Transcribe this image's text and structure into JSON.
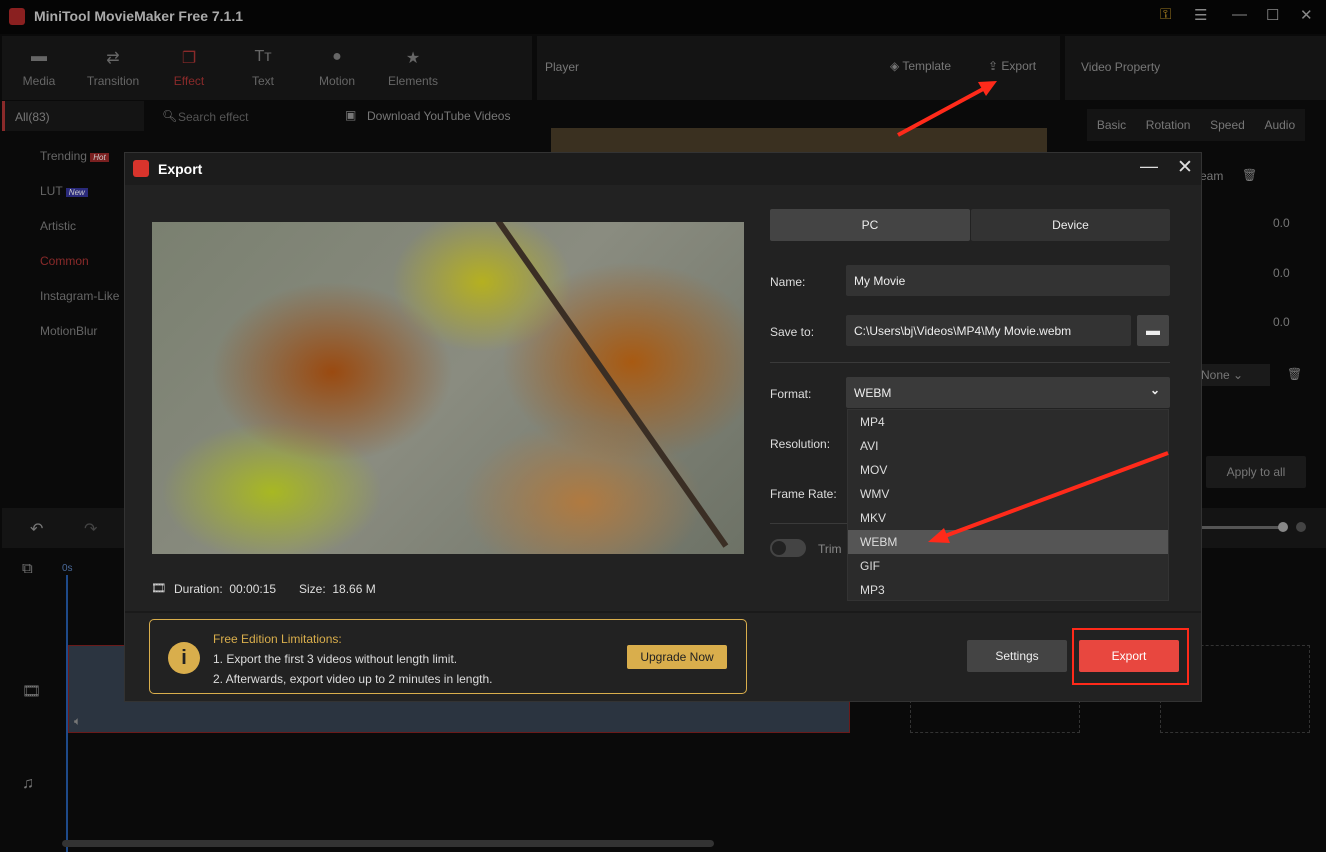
{
  "app": {
    "title": "MiniTool MovieMaker Free 7.1.1"
  },
  "toolbar": [
    {
      "label": "Media",
      "icon": "folder-icon"
    },
    {
      "label": "Transition",
      "icon": "transition-icon"
    },
    {
      "label": "Effect",
      "icon": "effect-icon"
    },
    {
      "label": "Text",
      "icon": "text-icon"
    },
    {
      "label": "Motion",
      "icon": "motion-icon"
    },
    {
      "label": "Elements",
      "icon": "elements-icon"
    }
  ],
  "effects": {
    "all": "All(83)",
    "search_placeholder": "Search effect",
    "download": "Download YouTube Videos",
    "categories": [
      {
        "label": "Trending",
        "badge": "Hot"
      },
      {
        "label": "LUT",
        "badge": "New"
      },
      {
        "label": "Artistic"
      },
      {
        "label": "Common"
      },
      {
        "label": "Instagram-Like"
      },
      {
        "label": "MotionBlur"
      }
    ]
  },
  "player": {
    "title": "Player",
    "template": "Template",
    "export": "Export"
  },
  "property": {
    "title": "Video Property",
    "tabs": [
      "Basic",
      "Rotation",
      "Speed",
      "Audio"
    ],
    "partial": "eam",
    "values": [
      "0.0",
      "0.0",
      "0.0"
    ],
    "none": "None",
    "apply_all": "Apply to all"
  },
  "timeline": {
    "time": "0s"
  },
  "dialog": {
    "title": "Export",
    "tabs": [
      "PC",
      "Device"
    ],
    "name_label": "Name:",
    "name": "My Movie",
    "save_label": "Save to:",
    "save_path": "C:\\Users\\bj\\Videos\\MP4\\My Movie.webm",
    "format_label": "Format:",
    "format": "WEBM",
    "resolution_label": "Resolution:",
    "framerate_label": "Frame Rate:",
    "trim_label": "Trim",
    "formats": [
      "MP4",
      "AVI",
      "MOV",
      "WMV",
      "MKV",
      "WEBM",
      "GIF",
      "MP3"
    ],
    "duration_label": "Duration:",
    "duration": "00:00:15",
    "size_label": "Size:",
    "size": "18.66 M",
    "limit_title": "Free Edition Limitations:",
    "limit_1": "1. Export the first 3 videos without length limit.",
    "limit_2": "2. Afterwards, export video up to 2 minutes in length.",
    "upgrade": "Upgrade Now",
    "settings": "Settings",
    "export": "Export"
  },
  "colors": {
    "accent": "#e8473f",
    "gold": "#d9ae4c",
    "highlight": "#ff2a1a"
  }
}
